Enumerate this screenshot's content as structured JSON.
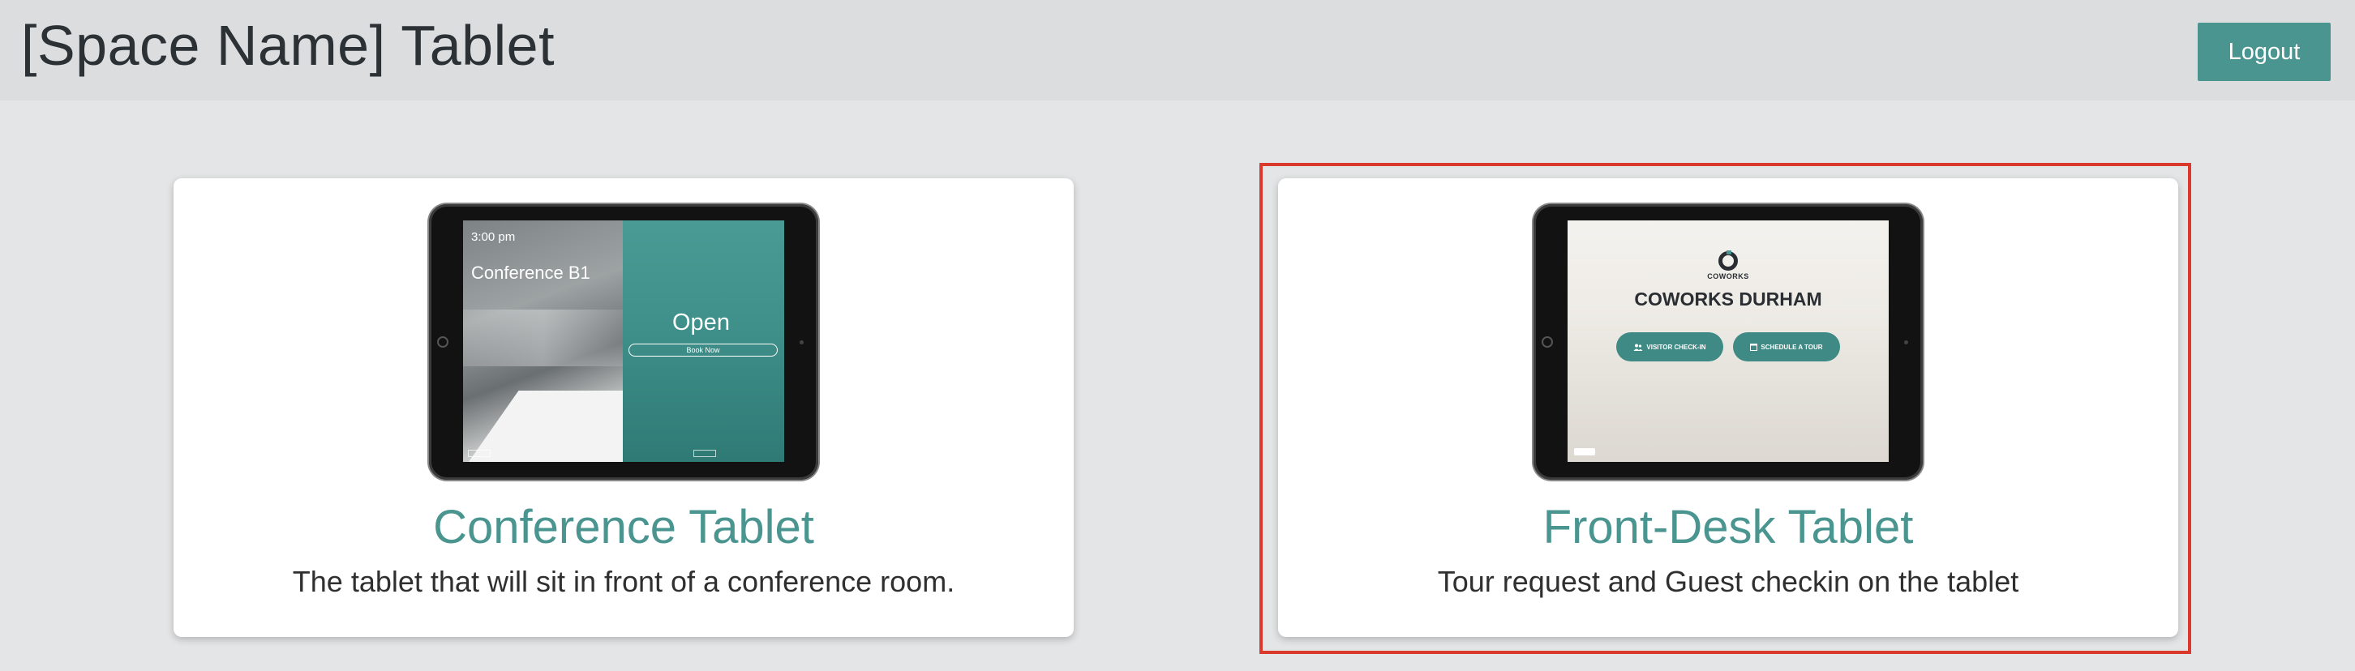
{
  "header": {
    "title": "[Space Name] Tablet",
    "logout_label": "Logout"
  },
  "cards": [
    {
      "title": "Conference Tablet",
      "description": "The tablet that will sit in front of a conference room.",
      "preview": {
        "time": "3:00 pm",
        "room": "Conference B1",
        "status": "Open",
        "book_label": "Book Now"
      }
    },
    {
      "title": "Front-Desk Tablet",
      "description": "Tour request and Guest checkin on the tablet",
      "selected": true,
      "preview": {
        "logo_text": "COWORKS",
        "space_name": "COWORKS DURHAM",
        "visitor_label": "VISITOR CHECK-IN",
        "tour_label": "SCHEDULE A TOUR"
      }
    }
  ],
  "colors": {
    "accent": "#4a9590",
    "highlight": "#d93a2b",
    "background": "#e4e5e6",
    "header": "#dcdddf"
  }
}
